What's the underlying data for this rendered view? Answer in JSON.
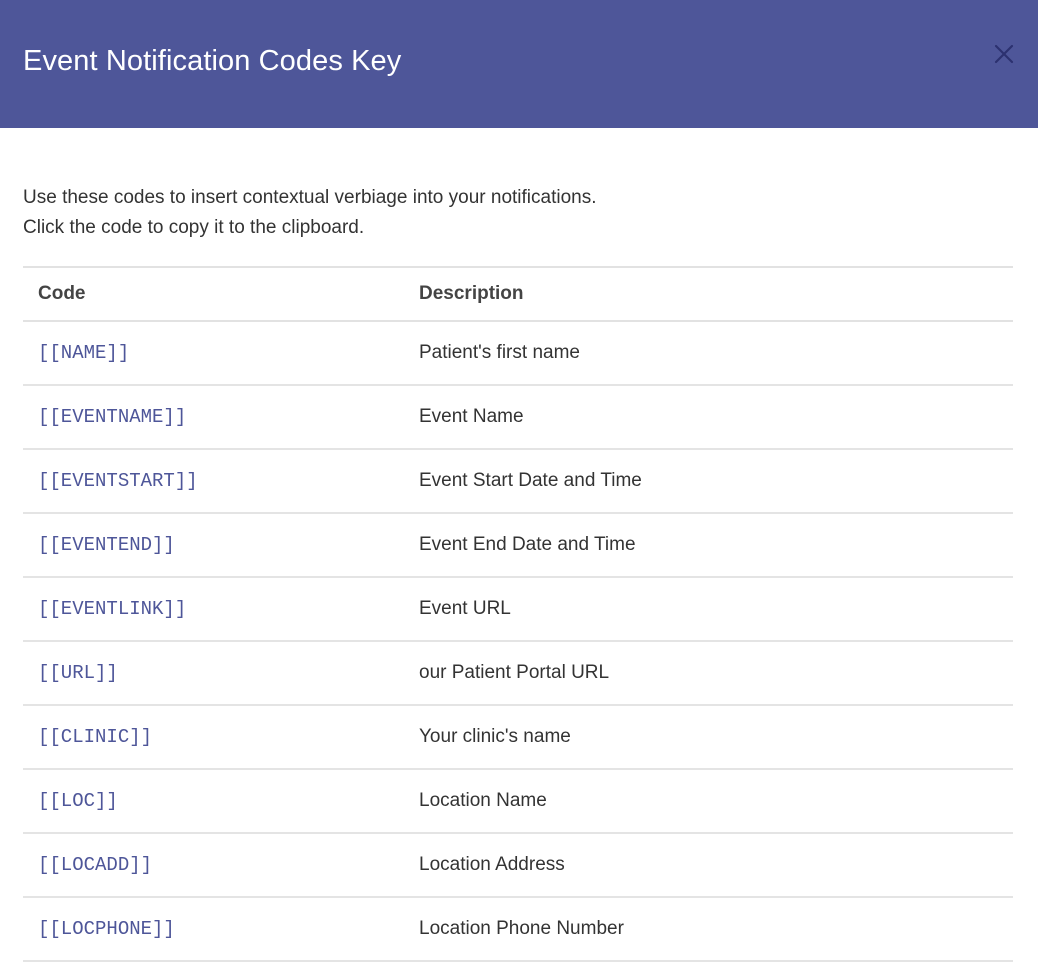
{
  "modal": {
    "title": "Event Notification Codes Key",
    "close_icon": "close-icon"
  },
  "intro": {
    "line1": "Use these codes to insert contextual verbiage into your notifications.",
    "line2": "Click the code to copy it to the clipboard."
  },
  "table": {
    "headers": {
      "code": "Code",
      "description": "Description"
    },
    "rows": [
      {
        "code": "[[NAME]]",
        "description": "Patient's first name"
      },
      {
        "code": "[[EVENTNAME]]",
        "description": "Event Name"
      },
      {
        "code": "[[EVENTSTART]]",
        "description": "Event Start Date and Time"
      },
      {
        "code": "[[EVENTEND]]",
        "description": "Event End Date and Time"
      },
      {
        "code": "[[EVENTLINK]]",
        "description": "Event URL"
      },
      {
        "code": "[[URL]]",
        "description": "our Patient Portal URL"
      },
      {
        "code": "[[CLINIC]]",
        "description": "Your clinic's name"
      },
      {
        "code": "[[LOC]]",
        "description": "Location Name"
      },
      {
        "code": "[[LOCADD]]",
        "description": "Location Address"
      },
      {
        "code": "[[LOCPHONE]]",
        "description": "Location Phone Number"
      }
    ]
  },
  "colors": {
    "header_bg": "#4e5699",
    "code_link": "#4e5699"
  }
}
